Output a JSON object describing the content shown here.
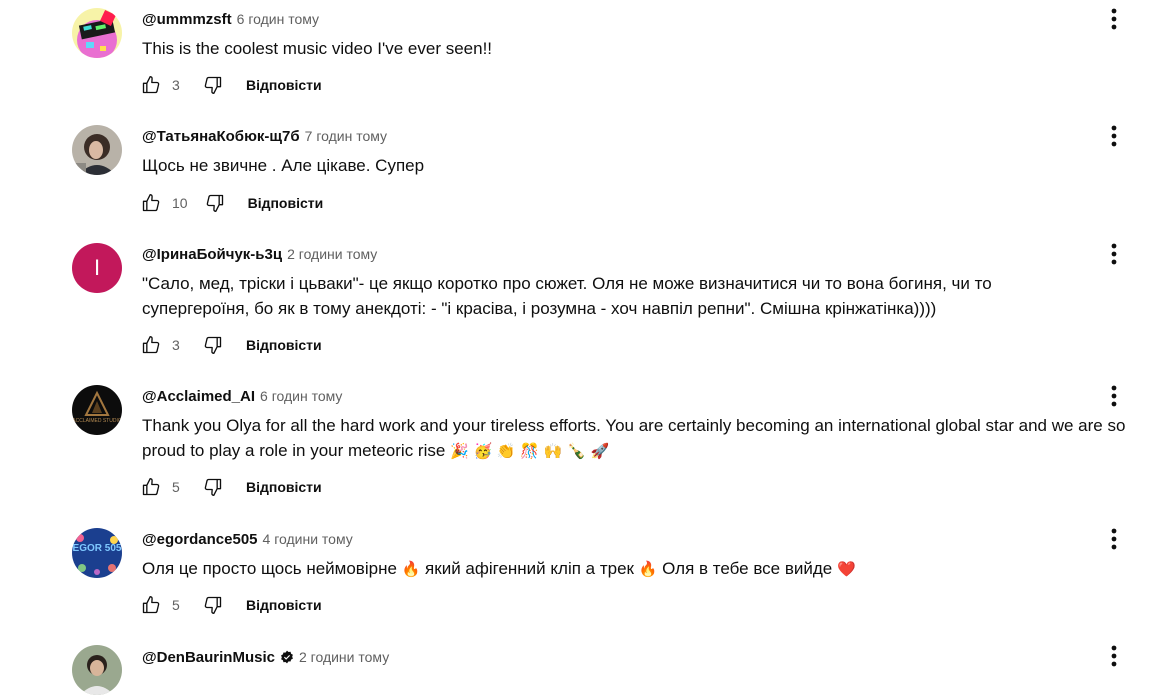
{
  "reply_label": "Відповісти",
  "comments": [
    {
      "author": "@ummmzsft",
      "time": "6 годин тому",
      "text": "This is the coolest music video I've ever seen!!",
      "likes": "3",
      "avatar": "colorful-cupcake-avatar"
    },
    {
      "author": "@ТатьянаКобюк-щ7б",
      "time": "7 годин тому",
      "text": "Щось не звичне . Але цікаве. Супер",
      "likes": "10",
      "avatar": "photo-woman-avatar"
    },
    {
      "author": "@ІринаБойчук-ь3ц",
      "time": "2 години тому",
      "text": "\"Сало, мед, тріски і цьваки\"- це якщо коротко про сюжет. Оля не може визначитися чи то вона богиня, чи то супергероїня, бо як в тому анекдоті: - \"і красіва, і розумна - хоч навпіл репни\". Смішна крінжатінка))))",
      "likes": "3",
      "avatar_letter": "І",
      "avatar_color": "#c2185b"
    },
    {
      "author": "@Acclaimed_AI",
      "time": "6 годин тому",
      "text": "Thank you Olya for all the hard work and your tireless efforts. You are certainly becoming an international global star and we are so proud to play a role in your meteoric rise",
      "emojis": "🎉 🥳 👏 🎊 🙌 🍾 🚀",
      "likes": "5",
      "avatar": "acclaimed-studio-logo",
      "avatar_text": "ACCLAIMED STUDIO"
    },
    {
      "author": "@egordance505",
      "time": "4 години тому",
      "text_parts": [
        "Оля це просто щось неймовірне ",
        "🔥",
        " який афігенний кліп а трек ",
        "🔥",
        " Оля в тебе все вийде ",
        "❤️"
      ],
      "likes": "5",
      "avatar": "egor-505-balloons-avatar",
      "avatar_text": "EGOR 505"
    },
    {
      "author": "@DenBaurinMusic",
      "time": "2 години тому",
      "verified": true,
      "avatar": "photo-man-avatar"
    }
  ]
}
